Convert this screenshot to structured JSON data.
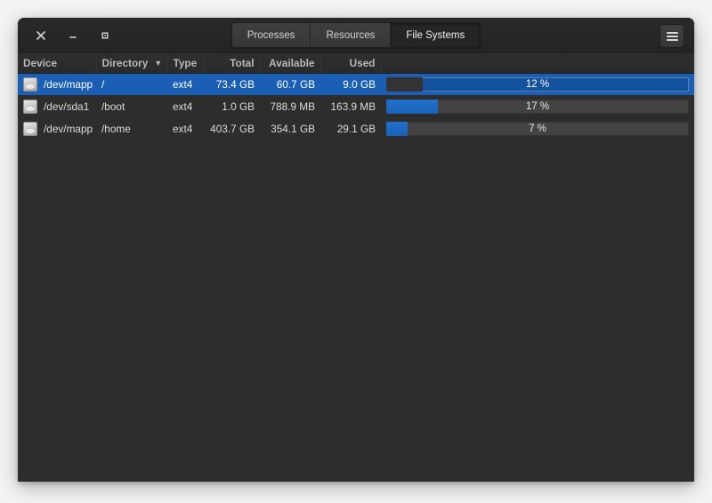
{
  "window": {
    "controls": [
      {
        "name": "close",
        "glyph": "×"
      },
      {
        "name": "minimize",
        "glyph": "–"
      },
      {
        "name": "maximize",
        "glyph": "□"
      }
    ],
    "menu_button_label": "menu"
  },
  "tabs": [
    {
      "label": "Processes",
      "active": false
    },
    {
      "label": "Resources",
      "active": false
    },
    {
      "label": "File Systems",
      "active": true
    }
  ],
  "table": {
    "columns": [
      {
        "label": "Device",
        "align": "left"
      },
      {
        "label": "Directory",
        "align": "left",
        "sort": "▼"
      },
      {
        "label": "Type",
        "align": "left"
      },
      {
        "label": "Total",
        "align": "right"
      },
      {
        "label": "Available",
        "align": "right"
      },
      {
        "label": "Used",
        "align": "right"
      },
      {
        "label": "",
        "align": "left"
      }
    ],
    "rows": [
      {
        "icon": "drive-icon",
        "device": "/dev/mapp",
        "directory": "/",
        "type": "ext4",
        "total": "73.4 GB",
        "available": "60.7 GB",
        "used": "9.0 GB",
        "percent_label": "12 %",
        "percent_value": 12,
        "selected": true
      },
      {
        "icon": "drive-icon",
        "device": "/dev/sda1",
        "directory": "/boot",
        "type": "ext4",
        "total": "1.0 GB",
        "available": "788.9 MB",
        "used": "163.9 MB",
        "percent_label": "17 %",
        "percent_value": 17,
        "selected": false
      },
      {
        "icon": "drive-icon",
        "device": "/dev/mapp",
        "directory": "/home",
        "type": "ext4",
        "total": "403.7 GB",
        "available": "354.1 GB",
        "used": "29.1 GB",
        "percent_label": "7 %",
        "percent_value": 7,
        "selected": false
      }
    ]
  },
  "colors": {
    "accent": "#1a5fb4",
    "progress_fill": "#1d69c4",
    "window_bg": "#2d2d2d",
    "header_bg": "#262626",
    "text": "#dcdcdc"
  }
}
